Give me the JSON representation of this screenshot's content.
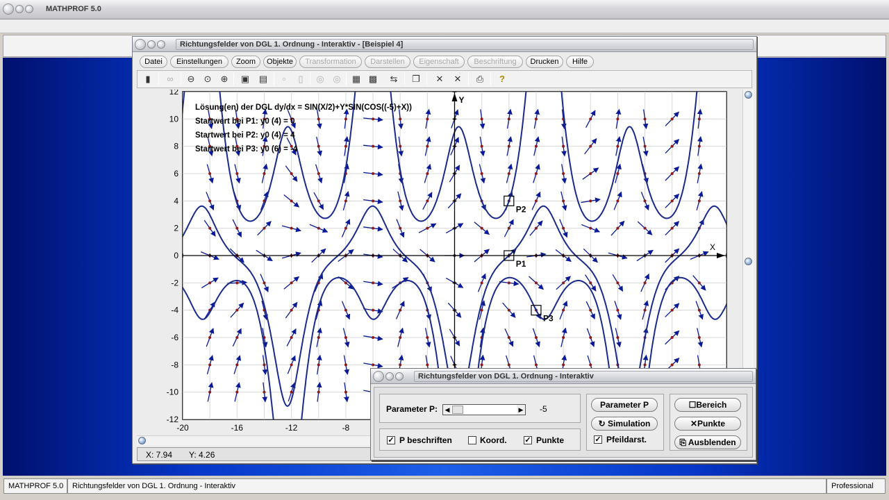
{
  "app": {
    "title": "MATHPROF 5.0"
  },
  "window": {
    "title": "Richtungsfelder von DGL 1. Ordnung - Interaktiv - [Beispiel 4]",
    "menu": [
      "Datei",
      "Einstellungen",
      "Zoom",
      "Objekte",
      "Transformation",
      "Darstellen",
      "Eigenschaft",
      "Beschriftung",
      "Drucken",
      "Hilfe"
    ],
    "menu_disabled": [
      "Transformation",
      "Darstellen",
      "Eigenschaft",
      "Beschriftung"
    ]
  },
  "plot": {
    "annotations": [
      "Lösung(en) der DGL dy/dx = SIN(X/2)+Y*SIN(COS((-5)+X))",
      "Startwert bei P1: y0 (4) = 0",
      "Startwert bei P2: y0 (4) = 4",
      "Startwert bei P3: y0 (6) = -4"
    ],
    "x_axis_label": "X",
    "y_axis_label": "Y",
    "x_ticks": [
      "-20",
      "-16",
      "-12",
      "-8"
    ],
    "y_ticks": [
      "12",
      "10",
      "8",
      "6",
      "4",
      "2",
      "0",
      "-2",
      "-4",
      "-6",
      "-8",
      "-10",
      "-12"
    ],
    "points": [
      {
        "label": "P1",
        "x": 4,
        "y": 0
      },
      {
        "label": "P2",
        "x": 4,
        "y": 4
      },
      {
        "label": "P3",
        "x": 6,
        "y": -4
      }
    ],
    "curve_color": "#1a2a8c",
    "arrow_color": "#0a1a96",
    "dot_color": "#8b1a1a"
  },
  "coords": {
    "x": "X: 7.94",
    "y": "Y: 4.26"
  },
  "dialog": {
    "title": "Richtungsfelder von DGL 1. Ordnung - Interaktiv",
    "param_label": "Parameter P:",
    "param_value": "-5",
    "check_p_beschriften": "P beschriften",
    "check_koord": "Koord.",
    "check_punkte": "Punkte",
    "check_pfeildarst": "Pfeildarst.",
    "btn_parameter": "Parameter P",
    "btn_simulation": "Simulation",
    "btn_bereich": "Bereich",
    "btn_punkte": "Punkte",
    "btn_ausblenden": "Ausblenden",
    "checked": {
      "p_beschriften": true,
      "koord": false,
      "punkte": true,
      "pfeildarst": true
    }
  },
  "statusbar": {
    "app": "MATHPROF 5.0",
    "module": "Richtungsfelder von DGL 1. Ordnung - Interaktiv",
    "edition": "Professional"
  }
}
